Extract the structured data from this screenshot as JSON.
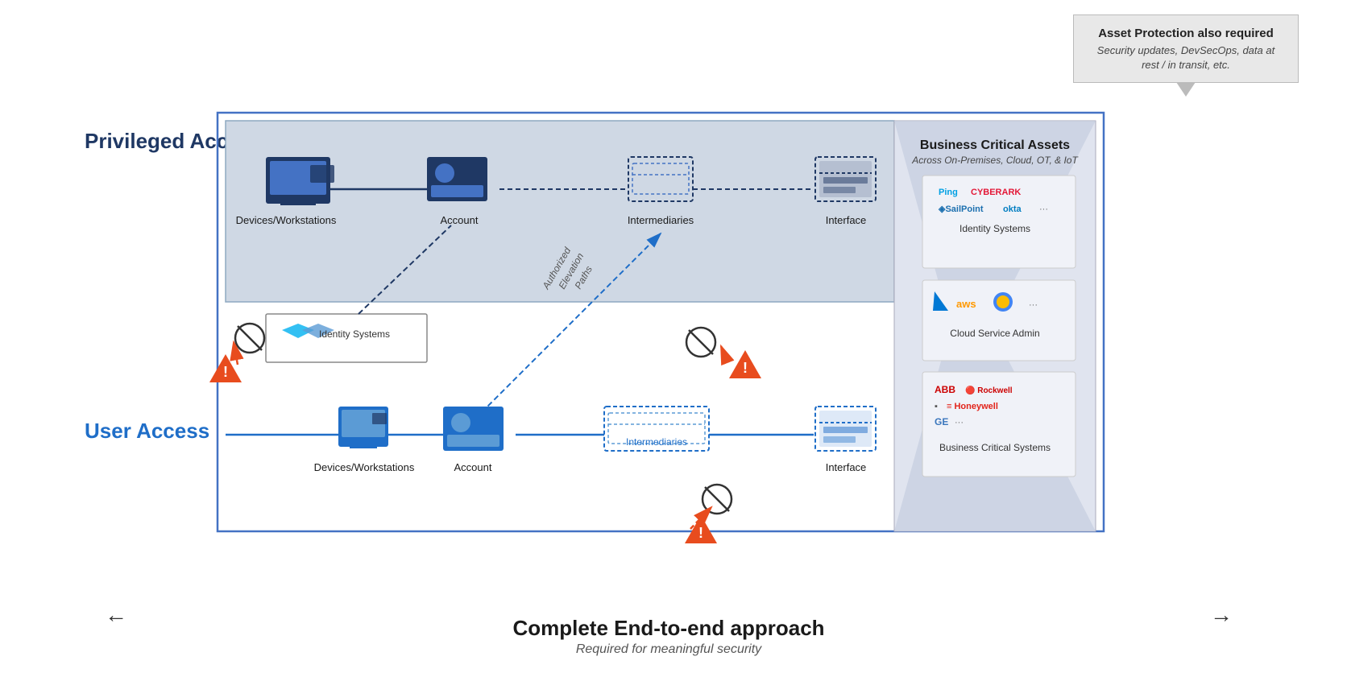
{
  "callout": {
    "title": "Asset Protection also required",
    "body": "Security updates, DevSecOps, data at rest / in transit, etc."
  },
  "sections": {
    "privileged": "Privileged Access",
    "user": "User Access"
  },
  "nodes": {
    "priv_devices": "Devices/Workstations",
    "priv_account": "Account",
    "priv_intermediaries": "Intermediaries",
    "priv_interface": "Interface",
    "identity_systems": "Identity Systems",
    "authorized_elevation": "Authorized\nElevation\nPaths",
    "user_devices": "Devices/Workstations",
    "user_account": "Account",
    "user_intermediaries": "Intermediaries",
    "user_interface": "Interface"
  },
  "bca": {
    "title": "Business Critical Assets",
    "subtitle": "Across On-Premises, Cloud, OT, & IoT",
    "identity_systems": {
      "label": "Identity Systems",
      "logos": [
        "Ping",
        "CyberArk",
        "SailPoint",
        "okta",
        "···"
      ]
    },
    "cloud_admin": {
      "label": "Cloud Service Admin",
      "logos": [
        "Azure",
        "aws",
        "GCP",
        "···"
      ]
    },
    "business_critical": {
      "label": "Business Critical Systems",
      "logos": [
        "ABB",
        "Rockwell Automation",
        "Honeywell",
        "GE",
        "···"
      ]
    }
  },
  "bottom": {
    "title": "Complete End-to-end approach",
    "subtitle": "Required for meaningful security",
    "arrow_left": "←",
    "arrow_right": "→"
  }
}
